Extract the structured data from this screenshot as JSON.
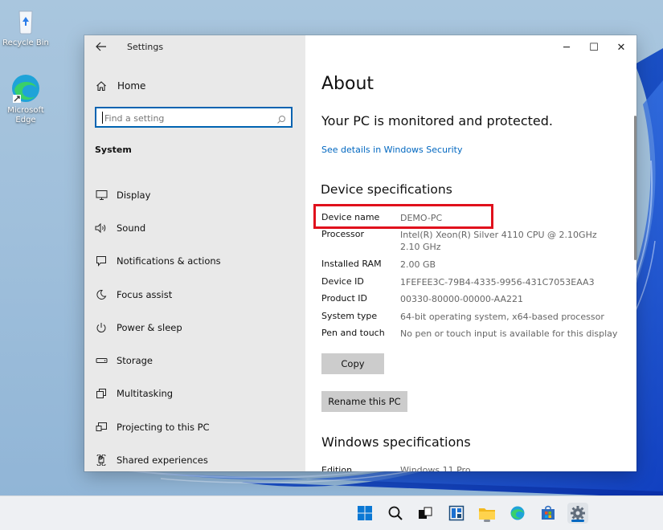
{
  "desktop": {
    "icons": [
      {
        "label": "Recycle Bin",
        "icon": "recycle-bin-icon"
      },
      {
        "label": "Microsoft Edge",
        "icon": "edge-icon"
      }
    ]
  },
  "window": {
    "title": "Settings",
    "controls": {
      "minimize": "─",
      "maximize": "☐",
      "close": "✕"
    }
  },
  "sidebar": {
    "home_label": "Home",
    "search_placeholder": "Find a setting",
    "section_title": "System",
    "items": [
      {
        "label": "Display",
        "icon": "display-icon"
      },
      {
        "label": "Sound",
        "icon": "sound-icon"
      },
      {
        "label": "Notifications & actions",
        "icon": "notifications-icon"
      },
      {
        "label": "Focus assist",
        "icon": "moon-icon"
      },
      {
        "label": "Power & sleep",
        "icon": "power-icon"
      },
      {
        "label": "Storage",
        "icon": "storage-icon"
      },
      {
        "label": "Multitasking",
        "icon": "multitasking-icon"
      },
      {
        "label": "Projecting to this PC",
        "icon": "projecting-icon"
      },
      {
        "label": "Shared experiences",
        "icon": "shared-experiences-icon"
      }
    ]
  },
  "content": {
    "title": "About",
    "protection_text": "Your PC is monitored and protected.",
    "security_link": "See details in Windows Security",
    "device_specs_title": "Device specifications",
    "specs": [
      {
        "key": "Device name",
        "value": "DEMO-PC"
      },
      {
        "key": "Processor",
        "value": "Intel(R) Xeon(R) Silver 4110 CPU @ 2.10GHz   2.10 GHz"
      },
      {
        "key": "Installed RAM",
        "value": "2.00 GB"
      },
      {
        "key": "Device ID",
        "value": "1FEFEE3C-79B4-4335-9956-431C7053EAA3"
      },
      {
        "key": "Product ID",
        "value": "00330-80000-00000-AA221"
      },
      {
        "key": "System type",
        "value": "64-bit operating system, x64-based processor"
      },
      {
        "key": "Pen and touch",
        "value": "No pen or touch input is available for this display"
      }
    ],
    "copy_button": "Copy",
    "rename_button": "Rename this PC",
    "windows_specs_title": "Windows specifications",
    "edition_key": "Edition",
    "edition_value": "Windows 11 Pro"
  },
  "taskbar": {
    "icons": [
      "start-icon",
      "search-icon",
      "task-view-icon",
      "widgets-icon",
      "file-explorer-icon",
      "edge-icon",
      "store-icon",
      "settings-icon"
    ]
  },
  "colors": {
    "accent": "#0067c0",
    "highlight_box": "#e0101c",
    "button_bg": "#cccccc"
  }
}
